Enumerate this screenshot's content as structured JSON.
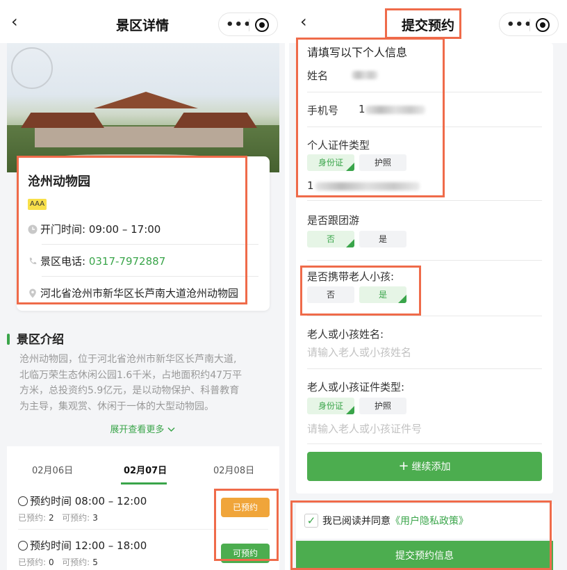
{
  "left": {
    "nav": {
      "back_icon": "‹",
      "title": "景区详情",
      "more": "•••"
    },
    "card": {
      "name": "沧州动物园",
      "level": "AAA",
      "open_label": "开门时间:",
      "open_value": "09:00 – 17:00",
      "phone_label": "景区电话:",
      "phone_value": "0317-7972887",
      "address": "河北省沧州市新华区长芦南大道沧州动物园"
    },
    "intro": {
      "heading": "景区介绍",
      "lines": [
        "沧州动物园，位于河北省沧州市新华区长芦南大道,",
        "北临万荣生态休闲公园1.6千米，占地面积约47万平",
        "方米，总投资约5.9亿元，是以动物保护、科普教育",
        "为主导，集观赏、休闲于一体的大型动物园。"
      ],
      "expand": "展开查看更多"
    },
    "dates": [
      "02月06日",
      "02月07日",
      "02月08日"
    ],
    "active_date_index": 1,
    "slots": [
      {
        "time": "预约时间 08:00 – 12:00",
        "booked_label": "已预约:",
        "booked": "2",
        "available_label": "可预约:",
        "available": "3",
        "button": "已预约",
        "button_color": "#f0a53a"
      },
      {
        "time": "预约时间 12:00 – 18:00",
        "booked_label": "已预约:",
        "booked": "0",
        "available_label": "可预约:",
        "available": "5",
        "button": "可预约",
        "button_color": "#4cad4f"
      }
    ]
  },
  "right": {
    "nav": {
      "back_icon": "‹",
      "title": "提交预约",
      "more": "•••"
    },
    "form": {
      "section_title": "请填写以下个人信息",
      "name_label": "姓名",
      "phone_label": "手机号",
      "phone_value_prefix": "1",
      "id_type_label": "个人证件类型",
      "id_options": [
        "身份证",
        "护照"
      ],
      "id_number_prefix": "1",
      "tour_label": "是否跟团游",
      "tour_options": [
        "否",
        "是"
      ],
      "elder_label": "是否携带老人小孩:",
      "elder_options": [
        "否",
        "是"
      ],
      "elder_name_label": "老人或小孩姓名:",
      "elder_name_placeholder": "请输入老人或小孩姓名",
      "elder_id_type_label": "老人或小孩证件类型:",
      "elder_id_options": [
        "身份证",
        "护照"
      ],
      "elder_id_placeholder": "请输入老人或小孩证件号",
      "add_button": "继续添加",
      "add_icon": "+"
    },
    "agree": {
      "text": "我已阅读并同意",
      "policy": "《用户隐私政策》",
      "check": "✓"
    },
    "submit": "提交预约信息"
  },
  "colors": {
    "accent": "#3aa54a",
    "highlight": "#ef6b4a",
    "booked": "#f0a53a"
  }
}
